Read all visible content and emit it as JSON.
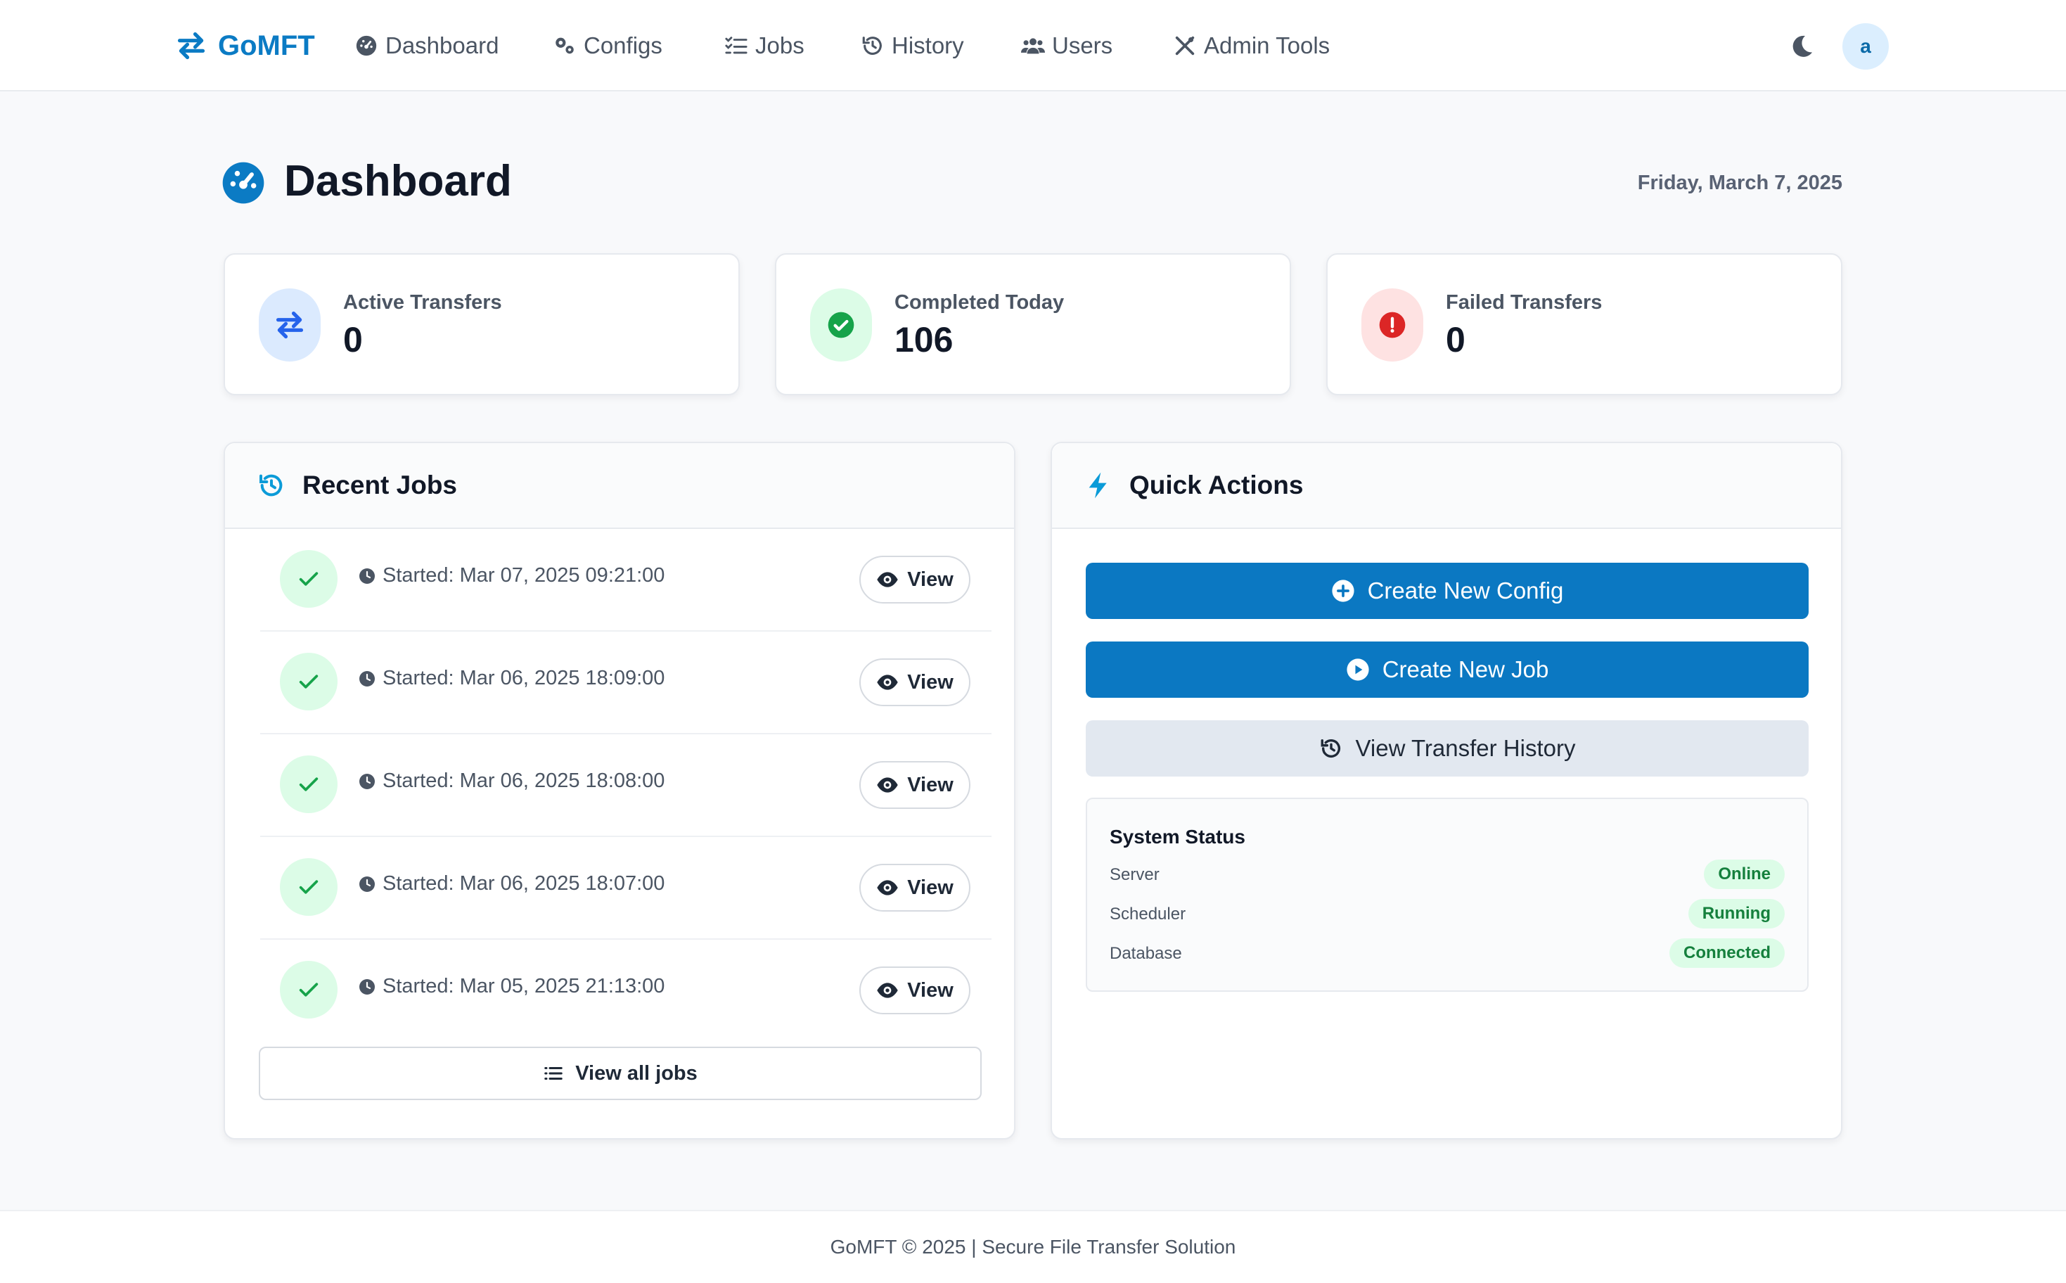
{
  "navbar": {
    "brand": "GoMFT",
    "items": [
      {
        "label": "Dashboard",
        "icon": "dashboard-gauge-icon"
      },
      {
        "label": "Configs",
        "icon": "gears-icon"
      },
      {
        "label": "Jobs",
        "icon": "list-check-icon"
      },
      {
        "label": "History",
        "icon": "history-icon"
      },
      {
        "label": "Users",
        "icon": "users-icon"
      },
      {
        "label": "Admin Tools",
        "icon": "tools-icon"
      }
    ],
    "theme_icon": "moon-icon",
    "avatar_initial": "a"
  },
  "page": {
    "title": "Dashboard",
    "date": "Friday, March 7, 2025"
  },
  "stats": [
    {
      "label": "Active Transfers",
      "value": "0",
      "icon": "arrows-exchange-icon",
      "color": "#2563eb",
      "bg": "#dbeafe"
    },
    {
      "label": "Completed Today",
      "value": "106",
      "icon": "check-circle-icon",
      "color": "#16a34a",
      "bg": "#dcfce7"
    },
    {
      "label": "Failed Transfers",
      "value": "0",
      "icon": "exclamation-circle-icon",
      "color": "#dc2626",
      "bg": "#fee2e2"
    }
  ],
  "recent_jobs": {
    "title": "Recent Jobs",
    "rows": [
      {
        "time": "Started: Mar 07, 2025 09:21:00",
        "action": "View"
      },
      {
        "time": "Started: Mar 06, 2025 18:09:00",
        "action": "View"
      },
      {
        "time": "Started: Mar 06, 2025 18:08:00",
        "action": "View"
      },
      {
        "time": "Started: Mar 06, 2025 18:07:00",
        "action": "View"
      },
      {
        "time": "Started: Mar 05, 2025 21:13:00",
        "action": "View"
      }
    ],
    "view_all": "View all jobs"
  },
  "quick_actions": {
    "title": "Quick Actions",
    "buttons": [
      {
        "label": "Create New Config",
        "icon": "plus-circle-icon"
      },
      {
        "label": "Create New Job",
        "icon": "play-circle-icon"
      },
      {
        "label": "View Transfer History",
        "icon": "history-icon"
      }
    ]
  },
  "system_status": {
    "title": "System Status",
    "rows": [
      {
        "label": "Server",
        "status": "Online"
      },
      {
        "label": "Scheduler",
        "status": "Running"
      },
      {
        "label": "Database",
        "status": "Connected"
      }
    ]
  },
  "footer": {
    "text": "GoMFT © 2025 | Secure File Transfer Solution"
  },
  "colors": {
    "primary": "#0b78c2",
    "success_bg": "#dcfce7",
    "success_text": "#15803d",
    "page_bg": "#f8f9fb"
  }
}
